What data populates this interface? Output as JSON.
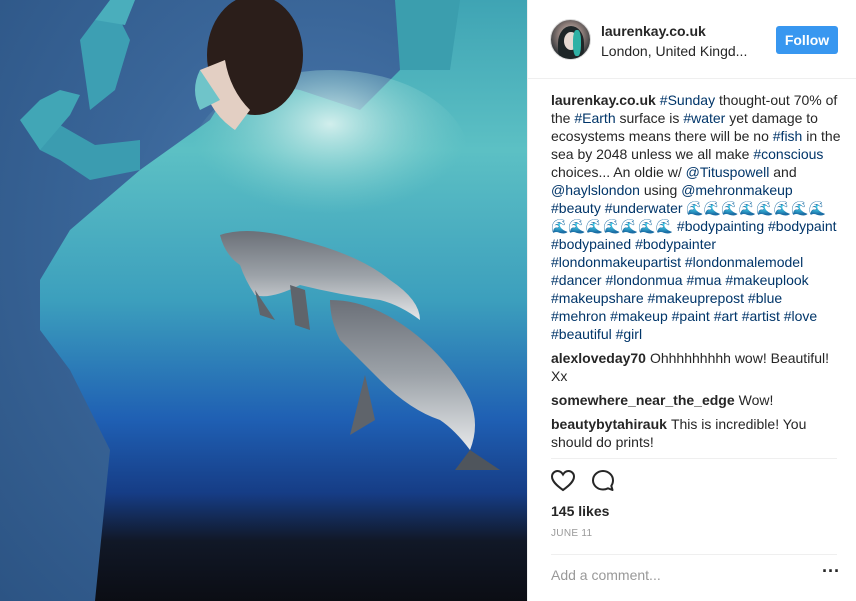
{
  "header": {
    "username": "laurenkay.co.uk",
    "location": "London, United Kingd...",
    "follow_label": "Follow"
  },
  "caption": {
    "username": "laurenkay.co.uk",
    "segments": [
      {
        "text": "#Sunday",
        "tag": true
      },
      {
        "text": " thought-out 70% of the ",
        "tag": false
      },
      {
        "text": "#Earth",
        "tag": true
      },
      {
        "text": " surface is ",
        "tag": false
      },
      {
        "text": "#water",
        "tag": true
      },
      {
        "text": " yet damage to ecosystems means there will be no ",
        "tag": false
      },
      {
        "text": "#fish",
        "tag": true
      },
      {
        "text": " in the sea by 2048 unless we all make ",
        "tag": false
      },
      {
        "text": "#conscious",
        "tag": true
      },
      {
        "text": " choices... An oldie w/ ",
        "tag": false
      },
      {
        "text": "@Tituspowell",
        "tag": true
      },
      {
        "text": " and ",
        "tag": false
      },
      {
        "text": "@haylslondon",
        "tag": true
      },
      {
        "text": " using ",
        "tag": false
      },
      {
        "text": "@mehronmakeup",
        "tag": true
      },
      {
        "text": " ",
        "tag": false
      },
      {
        "text": "#beauty",
        "tag": true
      },
      {
        "text": " ",
        "tag": false
      },
      {
        "text": "#underwater",
        "tag": true
      },
      {
        "text": " 🌊🌊🌊🌊🌊🌊🌊🌊🌊🌊🌊🌊🌊🌊🌊 ",
        "tag": false
      },
      {
        "text": "#bodypainting",
        "tag": true
      },
      {
        "text": " ",
        "tag": false
      },
      {
        "text": "#bodypaint",
        "tag": true
      },
      {
        "text": " ",
        "tag": false
      },
      {
        "text": "#bodypained",
        "tag": true
      },
      {
        "text": " ",
        "tag": false
      },
      {
        "text": "#bodypainter",
        "tag": true
      },
      {
        "text": " ",
        "tag": false
      },
      {
        "text": "#londonmakeupartist",
        "tag": true
      },
      {
        "text": " ",
        "tag": false
      },
      {
        "text": "#londonmalemodel",
        "tag": true
      },
      {
        "text": " ",
        "tag": false
      },
      {
        "text": "#dancer",
        "tag": true
      },
      {
        "text": " ",
        "tag": false
      },
      {
        "text": "#londonmua",
        "tag": true
      },
      {
        "text": " ",
        "tag": false
      },
      {
        "text": "#mua",
        "tag": true
      },
      {
        "text": " ",
        "tag": false
      },
      {
        "text": "#makeuplook",
        "tag": true
      },
      {
        "text": " ",
        "tag": false
      },
      {
        "text": "#makeupshare",
        "tag": true
      },
      {
        "text": " ",
        "tag": false
      },
      {
        "text": "#makeuprepost",
        "tag": true
      },
      {
        "text": " ",
        "tag": false
      },
      {
        "text": "#blue",
        "tag": true
      },
      {
        "text": " ",
        "tag": false
      },
      {
        "text": "#mehron",
        "tag": true
      },
      {
        "text": " ",
        "tag": false
      },
      {
        "text": "#makeup",
        "tag": true
      },
      {
        "text": " ",
        "tag": false
      },
      {
        "text": "#paint",
        "tag": true
      },
      {
        "text": " ",
        "tag": false
      },
      {
        "text": "#art",
        "tag": true
      },
      {
        "text": " ",
        "tag": false
      },
      {
        "text": "#artist",
        "tag": true
      },
      {
        "text": " ",
        "tag": false
      },
      {
        "text": "#love",
        "tag": true
      },
      {
        "text": " ",
        "tag": false
      },
      {
        "text": "#beautiful",
        "tag": true
      },
      {
        "text": " ",
        "tag": false
      },
      {
        "text": "#girl",
        "tag": true
      }
    ]
  },
  "comments": [
    {
      "username": "alexloveday70",
      "text": "Ohhhhhhhhh wow! Beautiful! Xx"
    },
    {
      "username": "somewhere_near_the_edge",
      "text": "Wow!"
    },
    {
      "username": "beautybytahirauk",
      "text": "This is incredible! You should do prints!"
    }
  ],
  "actions": {
    "like_icon": "heart-icon",
    "comment_icon": "comment-bubble-icon"
  },
  "likes": "145 likes",
  "date": "JUNE 11",
  "comment_box": {
    "placeholder": "Add a comment...",
    "more_icon": "ellipsis-icon"
  },
  "colors": {
    "accent": "#3897f0",
    "tag": "#003569",
    "muted": "#999999"
  }
}
